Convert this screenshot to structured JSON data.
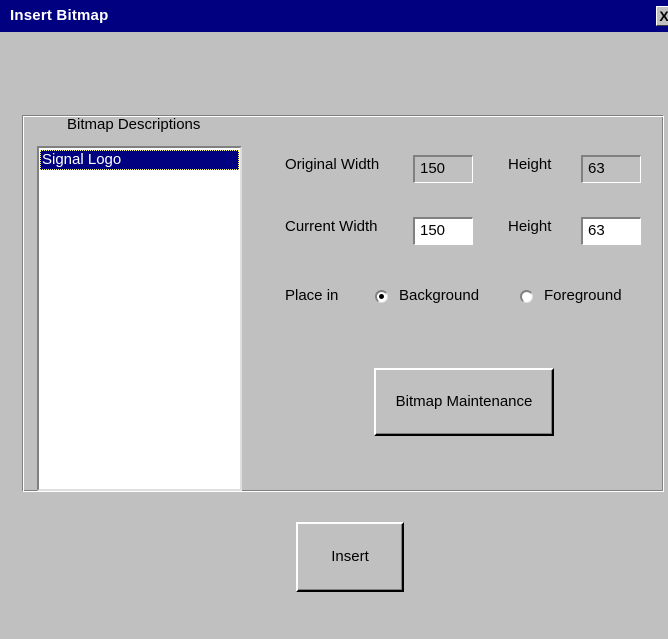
{
  "window": {
    "title": "Insert Bitmap",
    "close_glyph": "X"
  },
  "list": {
    "heading": "Bitmap Descriptions",
    "items": [
      "Signal Logo"
    ],
    "selected": "Signal Logo"
  },
  "original": {
    "width_label": "Original Width",
    "width_value": "150",
    "height_label": "Height",
    "height_value": "63"
  },
  "current": {
    "width_label": "Current Width",
    "width_value": "150",
    "height_label": "Height",
    "height_value": "63"
  },
  "place": {
    "label": "Place in",
    "options": [
      "Background",
      "Foreground"
    ],
    "selected": "Background"
  },
  "buttons": {
    "maintenance": "Bitmap Maintenance",
    "insert": "Insert"
  }
}
